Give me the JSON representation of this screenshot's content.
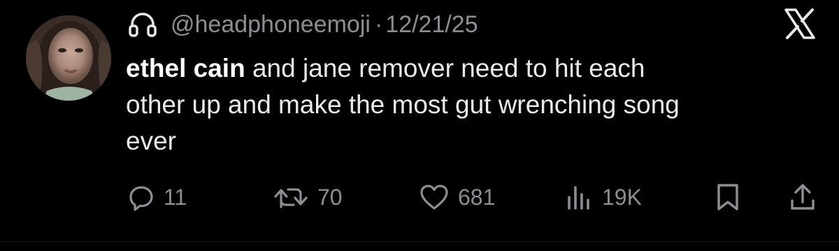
{
  "tweet": {
    "avatar_icon": "profile-photo",
    "emoji_icon": "headphone-icon",
    "handle": "@headphoneemoji",
    "separator": "·",
    "date": "12/21/25",
    "platform_icon": "x-logo",
    "text_bold": "ethel cain",
    "text_rest_line1": " and jane remover need to hit each",
    "text_line2": "other up and make the most gut wrenching song",
    "text_line3": "ever"
  },
  "actions": {
    "replies": "11",
    "reposts": "70",
    "likes": "681",
    "views": "19K",
    "bookmark_icon": "bookmark-icon",
    "share_icon": "share-icon"
  },
  "colors": {
    "background": "#000000",
    "text": "#e7e9ea",
    "muted": "#8b8f94"
  }
}
